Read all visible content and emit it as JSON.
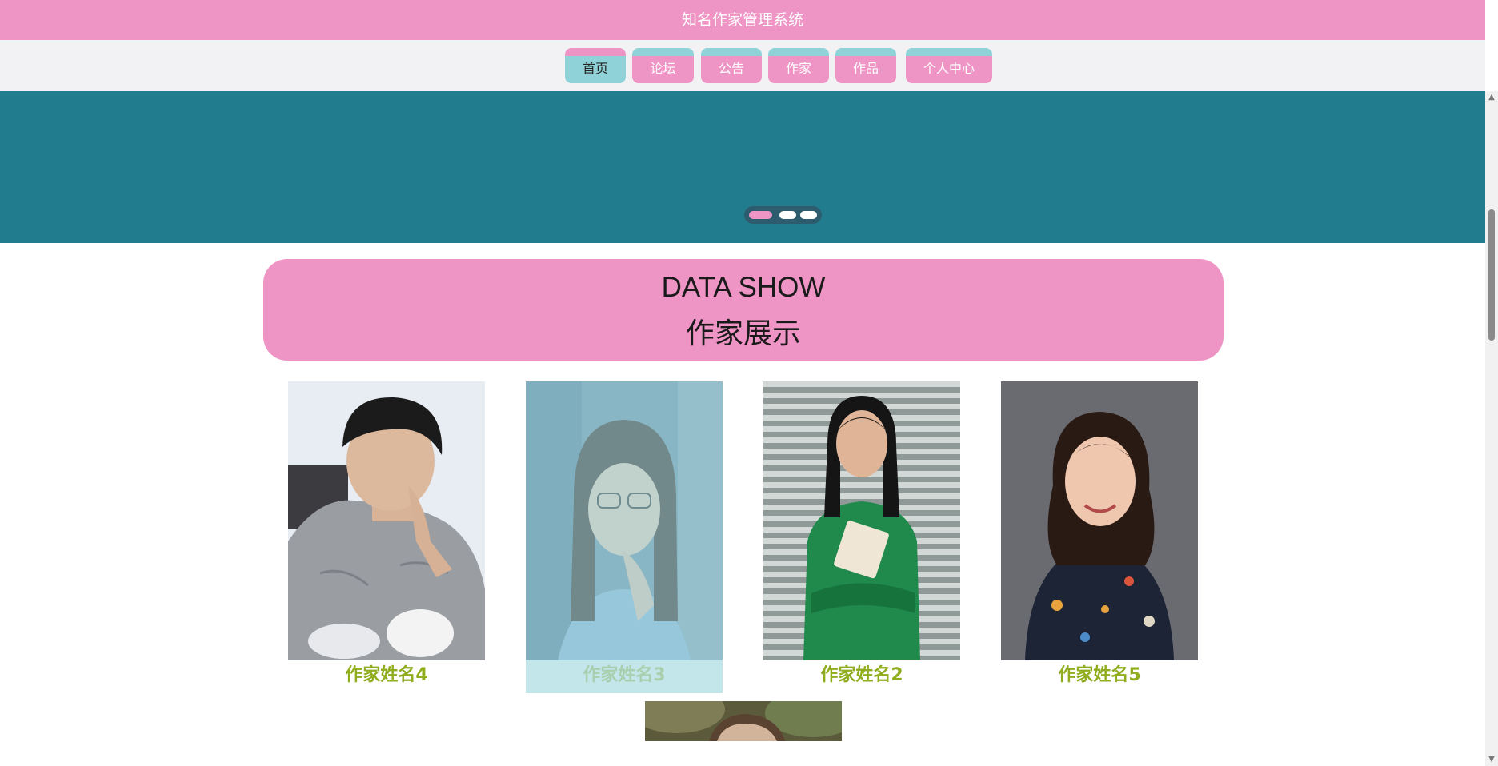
{
  "header": {
    "title": "知名作家管理系统"
  },
  "nav": {
    "items": [
      {
        "label": "首页",
        "active": true
      },
      {
        "label": "论坛",
        "active": false
      },
      {
        "label": "公告",
        "active": false
      },
      {
        "label": "作家",
        "active": false
      },
      {
        "label": "作品",
        "active": false
      },
      {
        "label": "个人中心",
        "active": false
      }
    ]
  },
  "banner": {
    "background_color": "#217d8d",
    "slide_count": 3,
    "active_slide": 1
  },
  "section": {
    "title_en": "DATA SHOW",
    "title_cn": "作家展示"
  },
  "writers": [
    {
      "name": "作家姓名4",
      "photo_icon": "writer-portrait-man-grey-shirt"
    },
    {
      "name": "作家姓名3",
      "photo_icon": "writer-portrait-woman-glasses"
    },
    {
      "name": "作家姓名2",
      "photo_icon": "writer-portrait-woman-green-dress"
    },
    {
      "name": "作家姓名5",
      "photo_icon": "writer-portrait-woman-floral-shirt"
    }
  ],
  "colors": {
    "pink": "#ef95c5",
    "teal": "#8fd2d7",
    "banner_teal": "#217d8d",
    "name_green": "#8fad1c"
  }
}
